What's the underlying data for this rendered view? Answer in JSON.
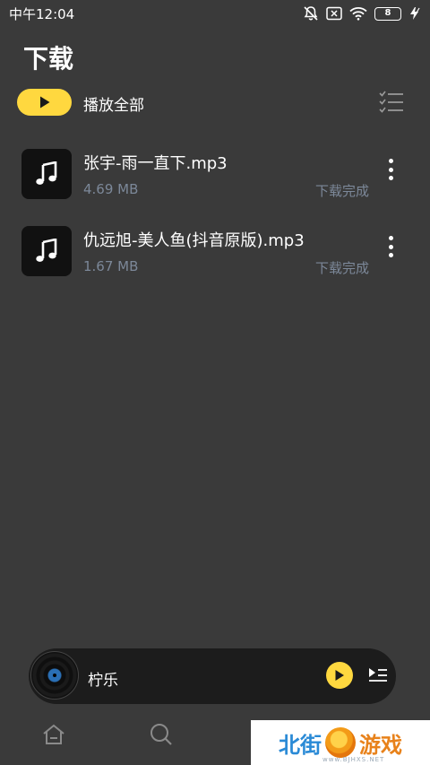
{
  "status_bar": {
    "time": "中午12:04",
    "battery": "8"
  },
  "header": {
    "title": "下载",
    "play_all_label": "播放全部"
  },
  "songs": [
    {
      "title": "张宇-雨一直下.mp3",
      "size": "4.69 MB",
      "status": "下载完成"
    },
    {
      "title": "仇远旭-美人鱼(抖音原版).mp3",
      "size": "1.67 MB",
      "status": "下载完成"
    }
  ],
  "player": {
    "title": "柠乐"
  },
  "watermark": {
    "left": "北街",
    "right": "游戏",
    "sub": "www.BJHXS.NET"
  },
  "colors": {
    "background": "#3a3a3a",
    "accent": "#ffd83f",
    "secondary_text": "#7c8899"
  }
}
